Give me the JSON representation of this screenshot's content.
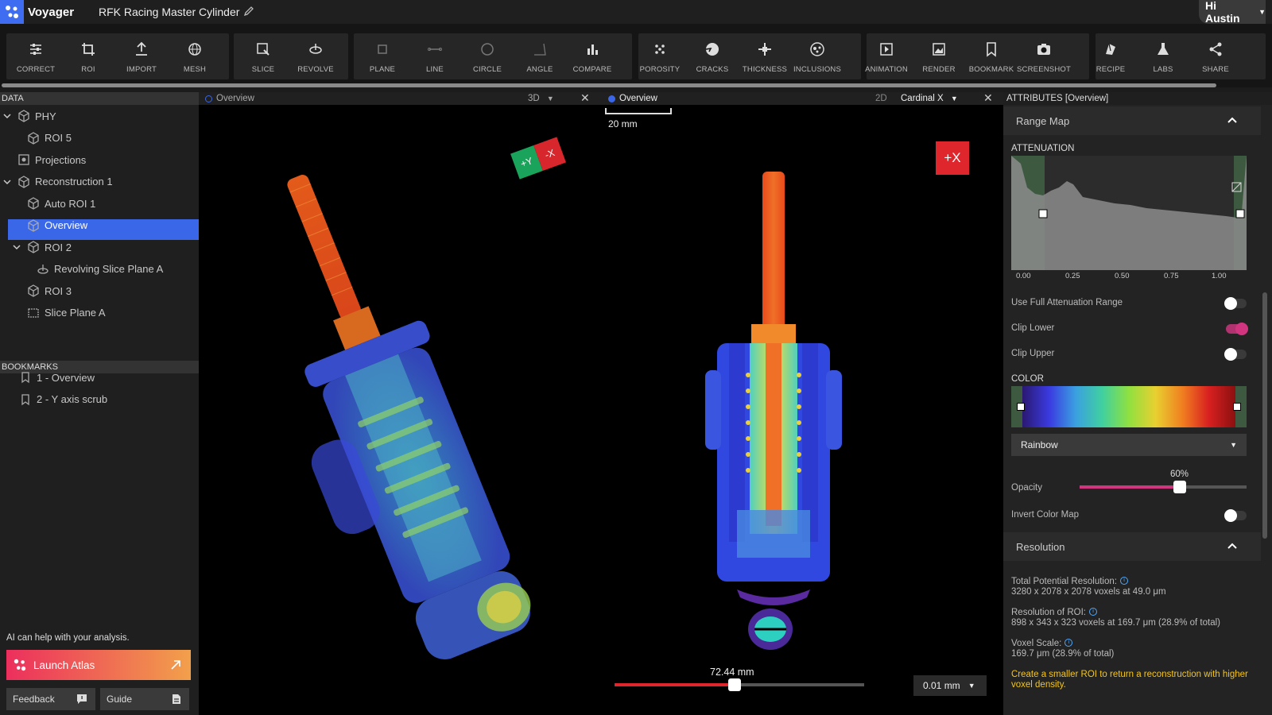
{
  "app": {
    "name": "Voyager",
    "project_title": "RFK Racing Master Cylinder",
    "user_greeting": "Hi Austin"
  },
  "toolbar": [
    {
      "label": "CORRECT",
      "icon": "sliders-icon"
    },
    {
      "label": "ROI",
      "icon": "crop-icon"
    },
    {
      "label": "IMPORT",
      "icon": "upload-icon"
    },
    {
      "label": "MESH",
      "icon": "mesh-sphere-icon"
    },
    {
      "label": "SLICE",
      "icon": "slice-icon"
    },
    {
      "label": "REVOLVE",
      "icon": "revolve-icon"
    },
    {
      "label": "PLANE",
      "icon": "plane-icon"
    },
    {
      "label": "LINE",
      "icon": "line-icon"
    },
    {
      "label": "CIRCLE",
      "icon": "circle-icon"
    },
    {
      "label": "ANGLE",
      "icon": "angle-icon"
    },
    {
      "label": "COMPARE",
      "icon": "bar-chart-icon"
    },
    {
      "label": "POROSITY",
      "icon": "porosity-icon"
    },
    {
      "label": "CRACKS",
      "icon": "cracks-icon"
    },
    {
      "label": "THICKNESS",
      "icon": "thickness-icon"
    },
    {
      "label": "INCLUSIONS",
      "icon": "inclusions-icon"
    },
    {
      "label": "ANIMATION",
      "icon": "play-icon"
    },
    {
      "label": "RENDER",
      "icon": "image-icon"
    },
    {
      "label": "BOOKMARK",
      "icon": "bookmark-icon"
    },
    {
      "label": "SCREENSHOT",
      "icon": "camera-icon"
    },
    {
      "label": "RECIPE",
      "icon": "recipe-icon"
    },
    {
      "label": "LABS",
      "icon": "flask-icon"
    },
    {
      "label": "SHARE",
      "icon": "share-icon"
    }
  ],
  "data_panel": {
    "title": "DATA",
    "items": [
      "PHY",
      "ROI 5",
      "Projections",
      "Reconstruction 1",
      "Auto ROI 1",
      "Overview",
      "ROI 2",
      "Revolving Slice Plane A",
      "ROI 3",
      "Slice Plane A"
    ]
  },
  "bookmarks": {
    "title": "BOOKMARKS",
    "items": [
      "1 - Overview",
      "2 - Y axis scrub"
    ]
  },
  "atlas": {
    "hint": "AI can help with your analysis.",
    "launch_label": "Launch Atlas"
  },
  "footer": {
    "feedback": "Feedback",
    "guide": "Guide"
  },
  "viewport_3d": {
    "title": "Overview",
    "mode": "3D",
    "gizmo_y": "+Y",
    "gizmo_x": "-X"
  },
  "viewport_2d": {
    "title": "Overview",
    "mode": "2D",
    "axis_select": "Cardinal X",
    "scale_bar": "20 mm",
    "axis_badge": "+X",
    "slice_position": "72.44 mm",
    "slice_fraction": 0.48,
    "step": "0.01 mm"
  },
  "attributes": {
    "title": "ATTRIBUTES [Overview]",
    "range_map": "Range Map",
    "attenuation": "ATTENUATION",
    "hist_ticks": [
      "0.00",
      "0.25",
      "0.50",
      "0.75",
      "1.00"
    ],
    "use_full_range": "Use Full Attenuation Range",
    "clip_lower": "Clip Lower",
    "clip_upper": "Clip Upper",
    "color": "COLOR",
    "colormap": "Rainbow",
    "opacity_label": "Opacity",
    "opacity_value": "60%",
    "opacity_fraction": 0.6,
    "invert": "Invert Color Map",
    "resolution_title": "Resolution",
    "total_res_label": "Total Potential Resolution:",
    "total_res_value": "3280 x 2078 x 2078 voxels at 49.0 μm",
    "roi_res_label": "Resolution of ROI:",
    "roi_res_value": "898 x 343 x 323 voxels at 169.7 μm (28.9% of total)",
    "voxel_label": "Voxel Scale:",
    "voxel_value": "169.7 μm (28.9% of total)",
    "hint": "Create a smaller ROI to return a reconstruction with higher voxel density."
  },
  "colors": {
    "accent": "#3a66e8",
    "atlas_start": "#ec2f5d",
    "atlas_end": "#f2a04b",
    "toggle_on": "#d2357f",
    "hint_yellow": "#f5c518",
    "badge_red": "#e0262d"
  }
}
